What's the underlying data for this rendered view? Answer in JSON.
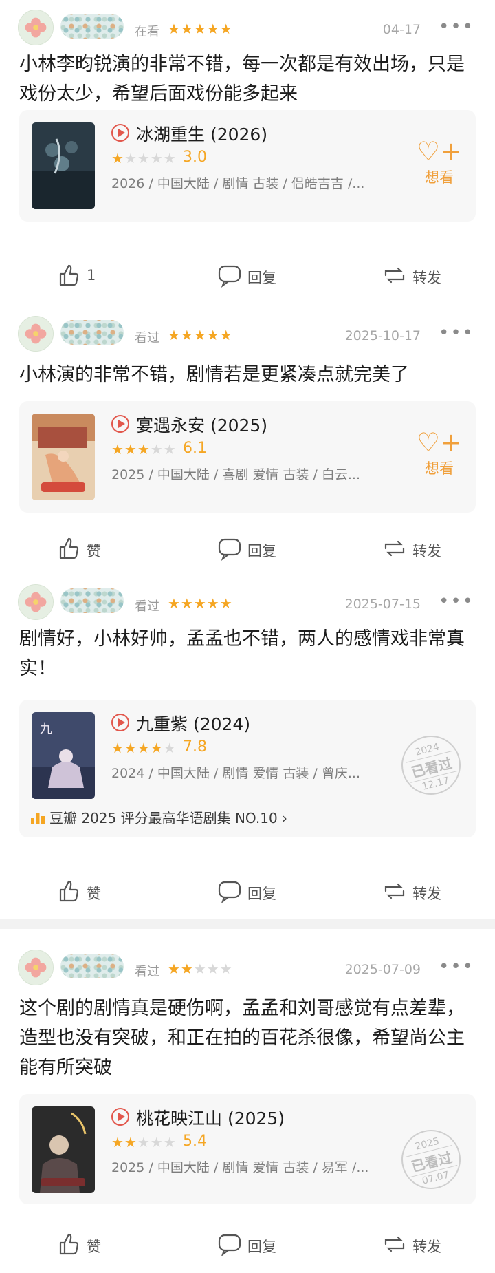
{
  "posts": [
    {
      "status": "在看",
      "rating": 5,
      "date": "04-17",
      "text": "小林李昀锐演的非常不错，每一次都是有效出场，只是戏份太少，希望后面戏份能多起来",
      "movie": {
        "title": "冰湖重生 (2026)",
        "rating": 1.5,
        "score": "3.0",
        "meta": "2026 / 中国大陆 / 剧情 古装 / 侣皓吉吉 /...",
        "action": "want",
        "want_label": "想看"
      },
      "likes": "1",
      "reply": "回复",
      "repost": "转发"
    },
    {
      "status": "看过",
      "rating": 5,
      "date": "2025-10-17",
      "text": "小林演的非常不错，剧情若是更紧凑点就完美了",
      "movie": {
        "title": "宴遇永安 (2025)",
        "rating": 3,
        "score": "6.1",
        "meta": "2025 / 中国大陆 / 喜剧 爱情 古装 / 白云...",
        "action": "want",
        "want_label": "想看"
      },
      "likes": "赞",
      "reply": "回复",
      "repost": "转发"
    },
    {
      "status": "看过",
      "rating": 5,
      "date": "2025-07-15",
      "text": "剧情好，小林好帅，孟孟也不错，两人的感情戏非常真实！",
      "movie": {
        "title": "九重紫 (2024)",
        "rating": 4,
        "score": "7.8",
        "meta": "2024 / 中国大陆 / 剧情 爱情 古装 / 曾庆...",
        "action": "stamp",
        "stamp_year": "2024",
        "stamp_label": "已看过",
        "stamp_date": "12.17",
        "rank": "豆瓣 2025 评分最高华语剧集 NO.10 ›"
      },
      "likes": "赞",
      "reply": "回复",
      "repost": "转发"
    },
    {
      "status": "看过",
      "rating": 2,
      "date": "2025-07-09",
      "text": "这个剧的剧情真是硬伤啊，孟孟和刘哥感觉有点差辈，造型也没有突破，和正在拍的百花杀很像，希望尚公主能有所突破",
      "movie": {
        "title": "桃花映江山 (2025)",
        "rating": 2.5,
        "score": "5.4",
        "meta": "2025 / 中国大陆 / 剧情 爱情 古装 / 易军 /...",
        "action": "stamp",
        "stamp_year": "2025",
        "stamp_label": "已看过",
        "stamp_date": "07.07"
      },
      "likes": "赞",
      "reply": "回复",
      "repost": "转发"
    }
  ],
  "poster_colors": [
    "#2a3a45",
    "#c98a5e",
    "#3f4a6b",
    "#2b2b2b"
  ],
  "accent": "#f5a623",
  "icons": {
    "like": "thumbs-up-icon",
    "reply": "speech-bubble-icon",
    "repost": "repost-arrows-icon",
    "want": "heart-plus-icon",
    "more": "more-dots-icon"
  }
}
